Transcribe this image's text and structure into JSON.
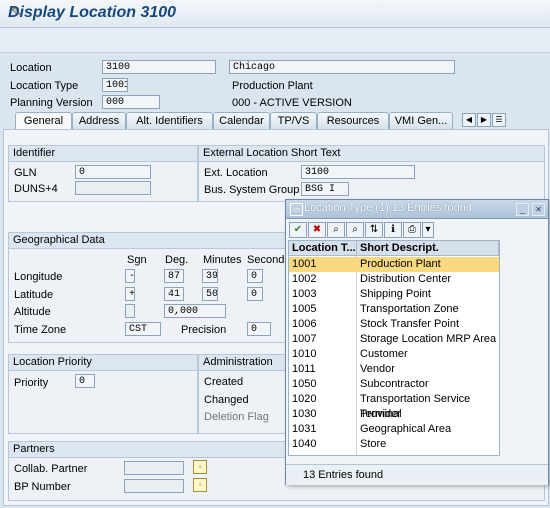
{
  "window": {
    "title": "Display Location 3100"
  },
  "header": {
    "location_label": "Location",
    "location_value": "3100",
    "location_name": "Chicago",
    "location_type_label": "Location Type",
    "location_type_value": "1001",
    "location_type_text": "Production Plant",
    "planning_version_label": "Planning Version",
    "planning_version_value": "000",
    "planning_version_text": "000 - ACTIVE VERSION"
  },
  "tabs": [
    "General",
    "Address",
    "Alt. Identifiers",
    "Calendar",
    "TP/VS",
    "Resources",
    "VMI Gen..."
  ],
  "identifier": {
    "title": "Identifier",
    "gln_label": "GLN",
    "gln_value": "0",
    "duns_label": "DUNS+4",
    "duns_value": ""
  },
  "external": {
    "title": "External Location Short Text",
    "ext_label": "Ext. Location",
    "ext_value": "3100",
    "bsg_label": "Bus. System Group",
    "bsg_value": "BSG I"
  },
  "geo": {
    "title": "Geographical Data",
    "col_sgn": "Sgn",
    "col_deg": "Deg.",
    "col_min": "Minutes",
    "col_sec": "Seconds",
    "longitude_label": "Longitude",
    "lon_sgn": "-",
    "lon_deg": "87",
    "lon_min": "39",
    "lon_sec": "0",
    "latitude_label": "Latitude",
    "lat_sgn": "+",
    "lat_deg": "41",
    "lat_min": "50",
    "lat_sec": "0",
    "altitude_label": "Altitude",
    "altitude_value": "0,000",
    "timezone_label": "Time Zone",
    "timezone_value": "CST",
    "precision_label": "Precision",
    "precision_value": "0"
  },
  "priority": {
    "title": "Location Priority",
    "label": "Priority",
    "value": "0"
  },
  "admin": {
    "title": "Administration",
    "created": "Created",
    "changed": "Changed",
    "deletion": "Deletion Flag"
  },
  "partners": {
    "title": "Partners",
    "collab_label": "Collab. Partner",
    "bp_label": "BP Number"
  },
  "popup": {
    "title": "Location Type (1)   13 Entries found",
    "col_key": "Location T...",
    "col_desc": "Short Descript.",
    "rows": [
      {
        "key": "1001",
        "desc": "Production Plant"
      },
      {
        "key": "1002",
        "desc": "Distribution Center"
      },
      {
        "key": "1003",
        "desc": "Shipping Point"
      },
      {
        "key": "1005",
        "desc": "Transportation Zone"
      },
      {
        "key": "1006",
        "desc": "Stock Transfer Point"
      },
      {
        "key": "1007",
        "desc": "Storage Location MRP Area"
      },
      {
        "key": "1010",
        "desc": "Customer"
      },
      {
        "key": "1011",
        "desc": "Vendor"
      },
      {
        "key": "1050",
        "desc": "Subcontractor"
      },
      {
        "key": "1020",
        "desc": "Transportation Service Provider"
      },
      {
        "key": "1030",
        "desc": "Terminal"
      },
      {
        "key": "1031",
        "desc": "Geographical Area"
      },
      {
        "key": "1040",
        "desc": "Store"
      }
    ],
    "status": "13 Entries found"
  },
  "colors": {
    "selected_row": "#f8d980",
    "title_text": "#18487c"
  }
}
